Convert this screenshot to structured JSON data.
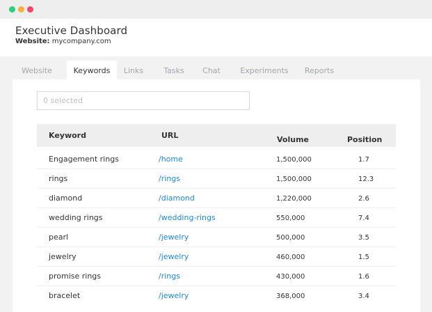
{
  "window": {
    "controls": [
      "green-dot",
      "yellow-dot",
      "red-dot"
    ]
  },
  "header": {
    "title": "Executive Dashboard",
    "website_label": "Website:",
    "website_value": "mycompany.com"
  },
  "tabs": [
    {
      "label": "Website",
      "active": false
    },
    {
      "label": "Keywords",
      "active": true
    },
    {
      "label": "Links",
      "active": false
    },
    {
      "label": "Tasks",
      "active": false
    },
    {
      "label": "Chat",
      "active": false
    },
    {
      "label": "Experiments",
      "active": false
    },
    {
      "label": "Reports",
      "active": false
    }
  ],
  "filter": {
    "placeholder": "0 selected"
  },
  "table": {
    "columns": {
      "keyword": "Keyword",
      "url": "URL",
      "volume": "Volume",
      "position": "Position"
    },
    "rows": [
      {
        "keyword": "Engagement rings",
        "url": "/home",
        "volume": "1,500,000",
        "position": "1.7"
      },
      {
        "keyword": "rings",
        "url": "/rings",
        "volume": "1,500,000",
        "position": "12.3"
      },
      {
        "keyword": "diamond",
        "url": "/diamond",
        "volume": "1,220,000",
        "position": "2.6"
      },
      {
        "keyword": "wedding rings",
        "url": "/wedding-rings",
        "volume": "550,000",
        "position": "7.4"
      },
      {
        "keyword": "pearl",
        "url": "/jewelry",
        "volume": "500,000",
        "position": "3.5"
      },
      {
        "keyword": "jewelry",
        "url": "/jewelry",
        "volume": "460,000",
        "position": "1.5"
      },
      {
        "keyword": "promise rings",
        "url": "/rings",
        "volume": "430,000",
        "position": "1.6"
      },
      {
        "keyword": "bracelet",
        "url": "/jewelry",
        "volume": "368,000",
        "position": "3.4"
      }
    ]
  },
  "colors": {
    "link": "#1e88d6",
    "tab_inactive": "#a0a6ad",
    "background": "#f2f2f2"
  }
}
